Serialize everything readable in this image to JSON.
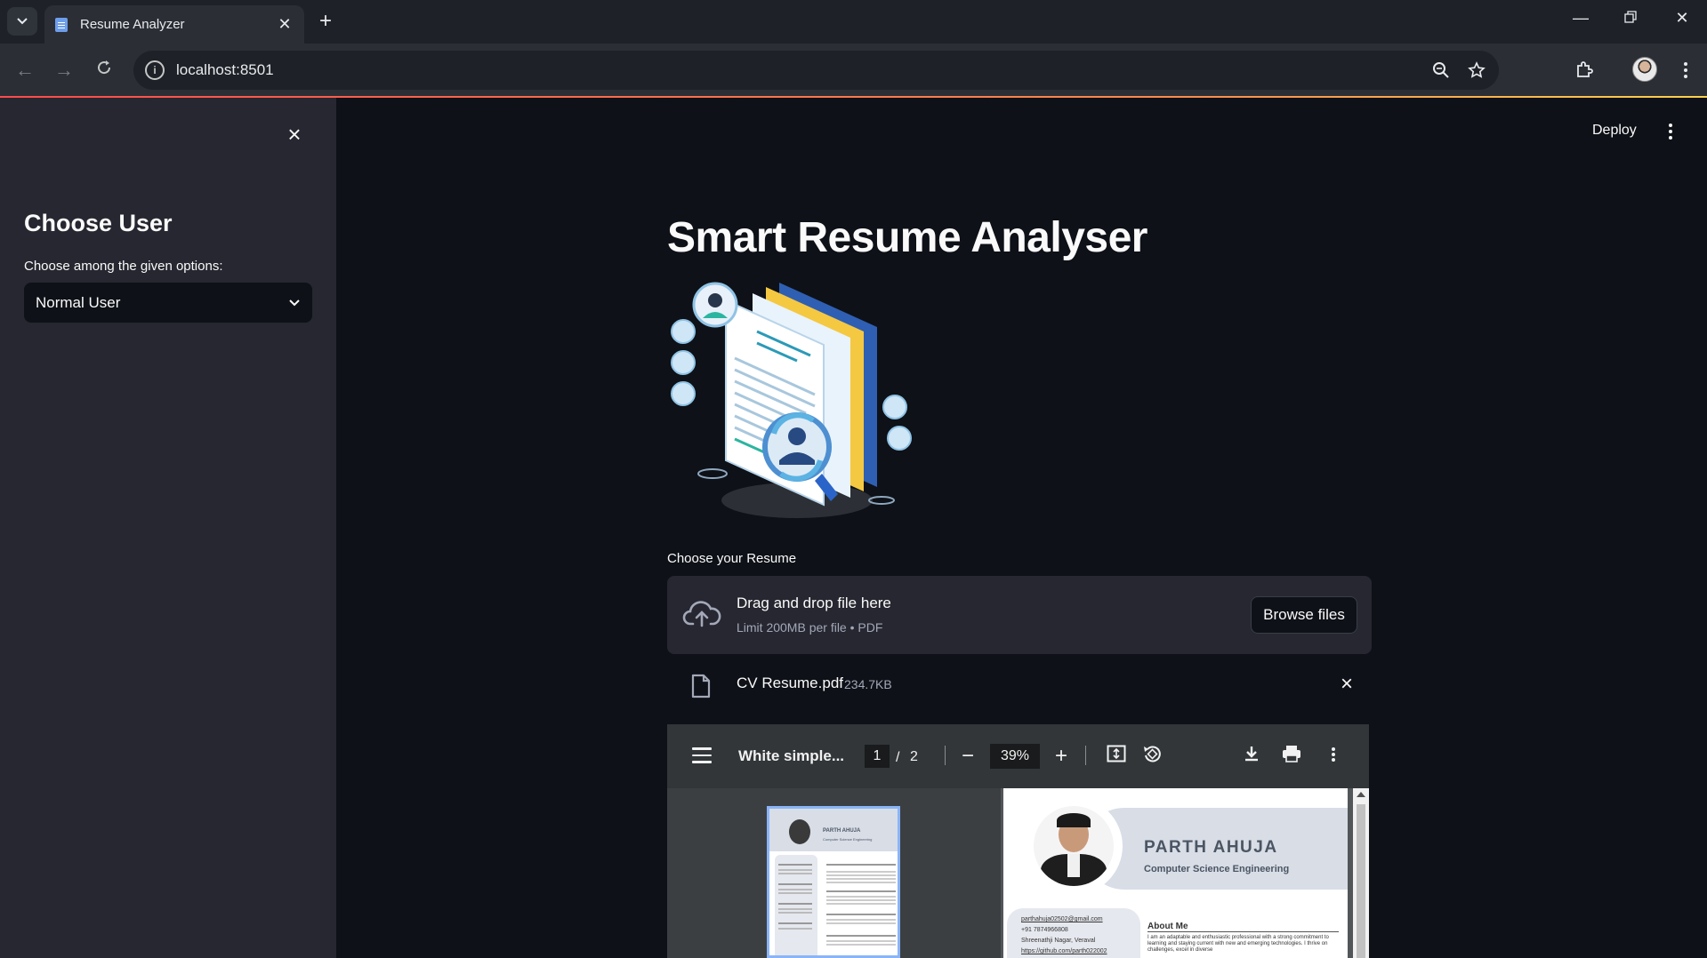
{
  "browser": {
    "tab_title": "Resume Analyzer",
    "url": "localhost:8501"
  },
  "header": {
    "deploy_label": "Deploy"
  },
  "sidebar": {
    "heading": "Choose User",
    "select_label": "Choose among the given options:",
    "select_value": "Normal User"
  },
  "main": {
    "title": "Smart Resume Analyser",
    "uploader": {
      "label": "Choose your Resume",
      "drop_text": "Drag and drop file here",
      "limit_text": "Limit 200MB per file • PDF",
      "browse_label": "Browse files"
    },
    "file": {
      "name": "CV Resume.pdf",
      "size": "234.7KB"
    }
  },
  "pdf_viewer": {
    "doc_title": "White simple...",
    "current_page": "1",
    "separator": "/",
    "total_pages": "2",
    "zoom": "39%",
    "page": {
      "name": "PARTH AHUJA",
      "role": "Computer Science Engineering",
      "about_heading": "About Me",
      "email": "parthahuja02502@gmail.com",
      "phone": "+91 7874966808",
      "address": "Shreenathji Nagar, Veraval",
      "github": "https://github.com/parth022002",
      "about_text": "I am an adaptable and enthusiastic professional with a strong commitment to learning and staying current with new and emerging technologies. I thrive on challenges, excel in diverse"
    },
    "thumb": {
      "name": "PARTH AHUJA",
      "role": "Computer Science Engineering"
    }
  },
  "colors": {
    "app_bg": "#0e1117",
    "sidebar_bg": "#262730",
    "accent": "#ff4b4b"
  }
}
